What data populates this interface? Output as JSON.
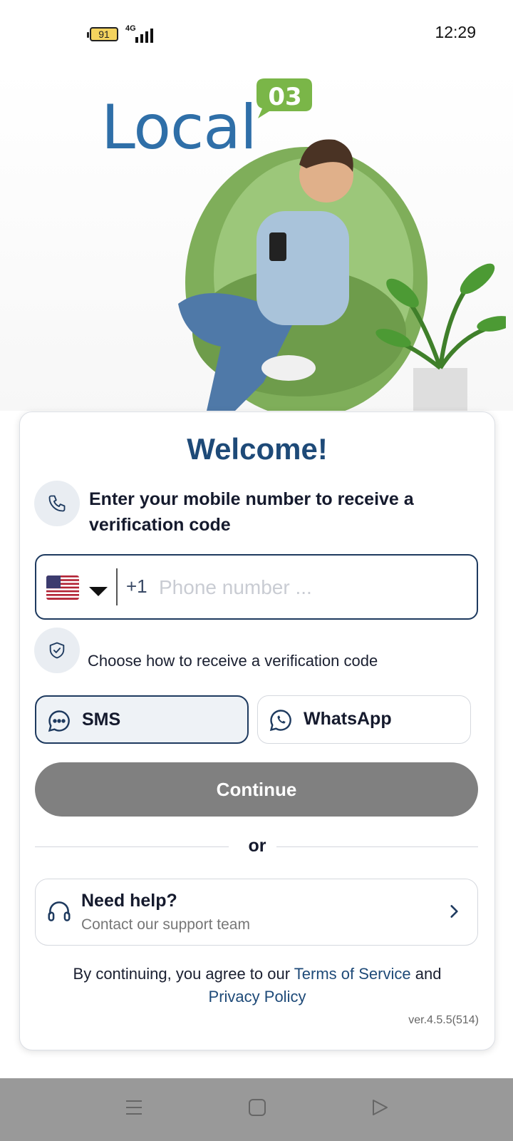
{
  "status_bar": {
    "battery": "91",
    "network": "4G",
    "time": "12:29"
  },
  "brand": {
    "logo_text": "Local",
    "logo_badge": "03"
  },
  "card": {
    "title": "Welcome!",
    "instruction": "Enter your mobile number to receive a verification code",
    "phone": {
      "country_code": "+1",
      "placeholder": "Phone number ..."
    },
    "choose_method": "Choose how to receive a verification code",
    "methods": [
      {
        "label": "SMS",
        "selected": true
      },
      {
        "label": "WhatsApp",
        "selected": false
      }
    ],
    "continue_label": "Continue",
    "or_label": "or",
    "help": {
      "title": "Need help?",
      "subtitle": "Contact our support team"
    },
    "terms": {
      "prefix": "By continuing, you agree to our",
      "tos": "Terms of Service",
      "and": "and",
      "privacy": "Privacy Policy"
    },
    "version": "ver.4.5.5(514)"
  },
  "colors": {
    "brand_blue": "#1e4a78",
    "logo_blue": "#2f6fa8",
    "logo_green": "#7ab648",
    "button_disabled": "#808080"
  },
  "nav_icons": [
    "menu-icon",
    "home-icon",
    "back-icon"
  ]
}
